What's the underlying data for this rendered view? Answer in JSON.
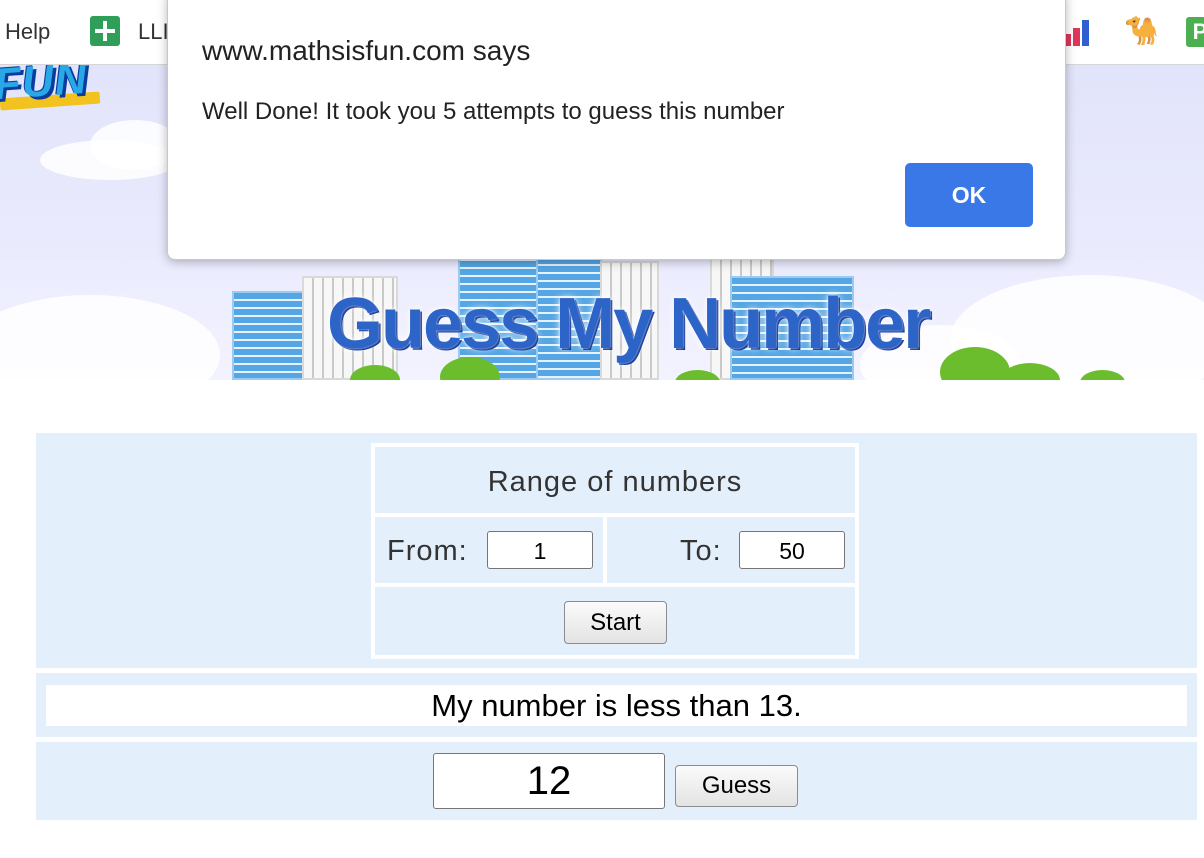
{
  "bookmarks": {
    "help_label": "Help",
    "lli_label": "LLI",
    "sheets_icon": "google-sheets-icon",
    "chart_icon": "bar-chart-icon",
    "camel_icon": "camel-icon",
    "p_label": "P"
  },
  "banner": {
    "logo_text": "FUN",
    "title": "Guess My Number"
  },
  "dialog": {
    "title": "www.mathsisfun.com says",
    "message": "Well Done! It took you 5 attempts to guess this number",
    "ok_label": "OK",
    "ok_color": "#3b78e7"
  },
  "game": {
    "range_title": "Range of numbers",
    "from_label": "From:",
    "from_value": "1",
    "to_label": "To:",
    "to_value": "50",
    "start_label": "Start",
    "status_message": "My number is less than 13.",
    "guess_value": "12",
    "guess_label": "Guess",
    "panel_color": "#e4effc"
  }
}
